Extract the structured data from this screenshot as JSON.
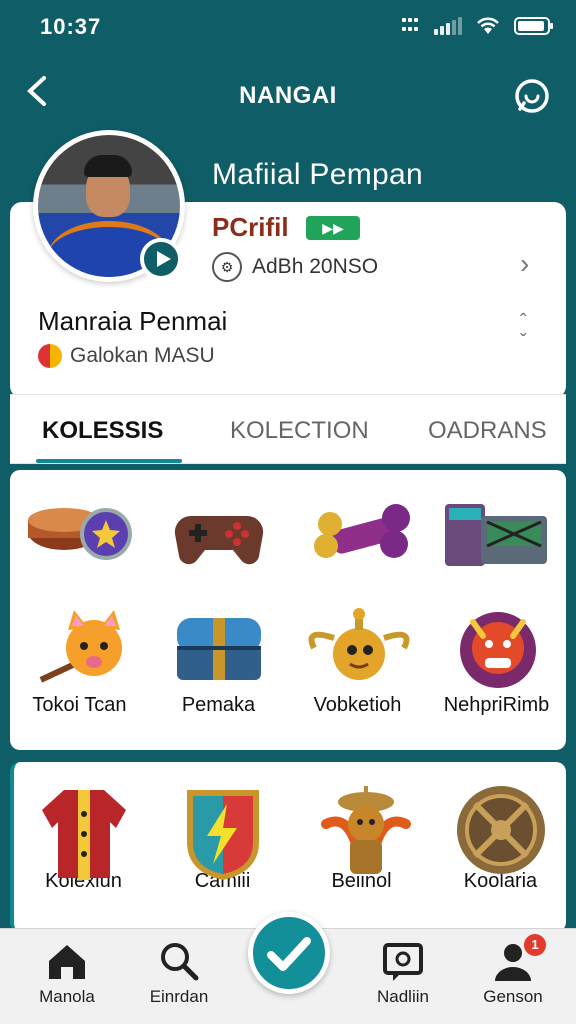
{
  "status_bar": {
    "time": "10:37"
  },
  "header": {
    "title": "NANGAI"
  },
  "profile": {
    "display_name": "Mafiial Pempan",
    "label": "PCrifil",
    "badge": "▶▶",
    "id_line": "AdBh 20NSO",
    "secondary_name": "Manraia Penmai",
    "secondary_sub": "Galokan MASU"
  },
  "tabs": [
    {
      "label": "KOLESSIS"
    },
    {
      "label": "KOLECTION"
    },
    {
      "label": "OADRANS"
    }
  ],
  "collection": {
    "items": [
      {
        "icon": "drum-shield-icon"
      },
      {
        "icon": "gamepad-icon"
      },
      {
        "icon": "bone-icon"
      },
      {
        "icon": "crate-icon"
      },
      {
        "icon": "fox-hammer-icon",
        "label": "Tokoi Tcan"
      },
      {
        "icon": "blue-chest-icon",
        "label": "Pemaka"
      },
      {
        "icon": "golden-creature-icon",
        "label": "Vobketioh"
      },
      {
        "icon": "red-beast-icon",
        "label": "NehpriRimb"
      }
    ],
    "items2": [
      {
        "icon": "red-jacket-icon",
        "label": "Kolexiun"
      },
      {
        "icon": "lightning-shield-icon",
        "label": "Camiii"
      },
      {
        "icon": "phoenix-warrior-icon",
        "label": "Beiinol"
      },
      {
        "icon": "bronze-shield-icon",
        "label": "Koolaria"
      }
    ]
  },
  "bottom_nav": {
    "items": [
      {
        "label": "Manola",
        "icon": "home-icon"
      },
      {
        "label": "Einrdan",
        "icon": "search-icon"
      },
      {
        "label": "Nadliin",
        "icon": "message-icon"
      },
      {
        "label": "Genson",
        "icon": "profile-icon",
        "badge": "1"
      }
    ]
  }
}
